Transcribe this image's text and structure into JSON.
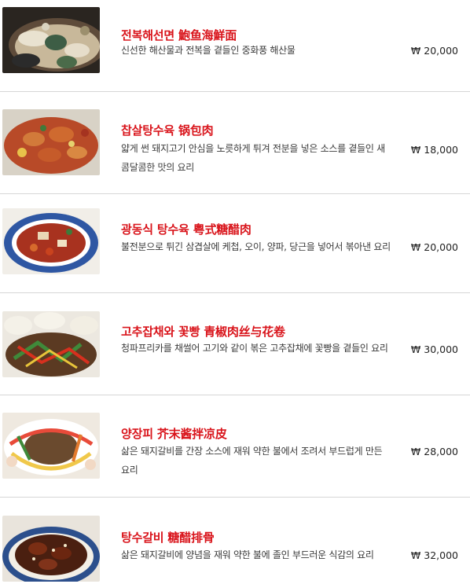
{
  "menu": {
    "items": [
      {
        "title": "전복해선면 鮑鱼海鮮面",
        "description": "신선한 해산물과 전복을 곁들인 중화풍 해산물",
        "price": "₩ 20,000",
        "image": "abalone-seafood-noodle-photo"
      },
      {
        "title": "찹살탕수육 锅包肉",
        "description": "얇게 썬 돼지고기 안심을 노릇하게 튀겨 전분을 넣은 소스를 곁들인 새콤달콤한 맛의 요리",
        "price": "₩ 18,000",
        "image": "sweet-sour-pork-photo"
      },
      {
        "title": "광동식 탕수육 粤式糖醋肉",
        "description": "불전분으로 튀긴 삼겹살에 케첩, 오이, 양파, 당근을 넣어서 볶아낸 요리",
        "price": "₩ 20,000",
        "image": "cantonese-sweet-sour-pork-photo"
      },
      {
        "title": "고추잡채와 꽃빵 青椒肉丝与花卷",
        "description": "청파프리카를 채썰어 고기와 같이 볶은 고추잡채에 꽃빵을 곁들인 요리",
        "price": "₩ 30,000",
        "image": "pepper-pork-with-buns-photo"
      },
      {
        "title": "양장피 芥末酱拌凉皮",
        "description": "삶은 돼지갈비를 간장 소스에 재워 약한 불에서 조려서 부드럽게 만든 요리",
        "price": "₩ 28,000",
        "image": "yangjangpi-cold-platter-photo"
      },
      {
        "title": "탕수갈비 糖醋排骨",
        "description": "삶은 돼지갈비에 양념을 재워 약한 불에 졸인 부드러운 식감의 요리",
        "price": "₩ 32,000",
        "image": "sweet-sour-ribs-photo"
      }
    ]
  }
}
